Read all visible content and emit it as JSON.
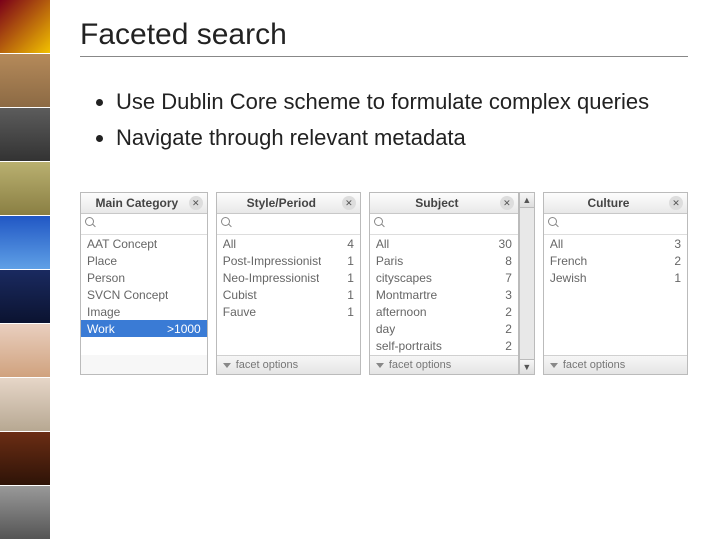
{
  "title": "Faceted search",
  "bullets": [
    "Use Dublin Core scheme to formulate complex queries",
    "Navigate through relevant metadata"
  ],
  "panels": {
    "main_category": {
      "header": "Main Category",
      "items": [
        {
          "label": "AAT Concept",
          "count": ""
        },
        {
          "label": "Place",
          "count": ""
        },
        {
          "label": "Person",
          "count": ""
        },
        {
          "label": "SVCN Concept",
          "count": ""
        },
        {
          "label": "Image",
          "count": ""
        },
        {
          "label": "Work",
          "count": ">1000",
          "selected": true
        }
      ]
    },
    "style_period": {
      "header": "Style/Period",
      "items": [
        {
          "label": "All",
          "count": "4"
        },
        {
          "label": "Post-Impressionist",
          "count": "1"
        },
        {
          "label": "Neo-Impressionist",
          "count": "1"
        },
        {
          "label": "Cubist",
          "count": "1"
        },
        {
          "label": "Fauve",
          "count": "1"
        }
      ],
      "footer": "facet options"
    },
    "subject": {
      "header": "Subject",
      "items": [
        {
          "label": "All",
          "count": "30"
        },
        {
          "label": "Paris",
          "count": "8"
        },
        {
          "label": "cityscapes",
          "count": "7"
        },
        {
          "label": "Montmartre",
          "count": "3"
        },
        {
          "label": "afternoon",
          "count": "2"
        },
        {
          "label": "day",
          "count": "2"
        },
        {
          "label": "self-portraits",
          "count": "2"
        }
      ],
      "footer": "facet options"
    },
    "culture": {
      "header": "Culture",
      "items": [
        {
          "label": "All",
          "count": "3"
        },
        {
          "label": "French",
          "count": "2"
        },
        {
          "label": "Jewish",
          "count": "1"
        }
      ],
      "footer": "facet options"
    }
  }
}
